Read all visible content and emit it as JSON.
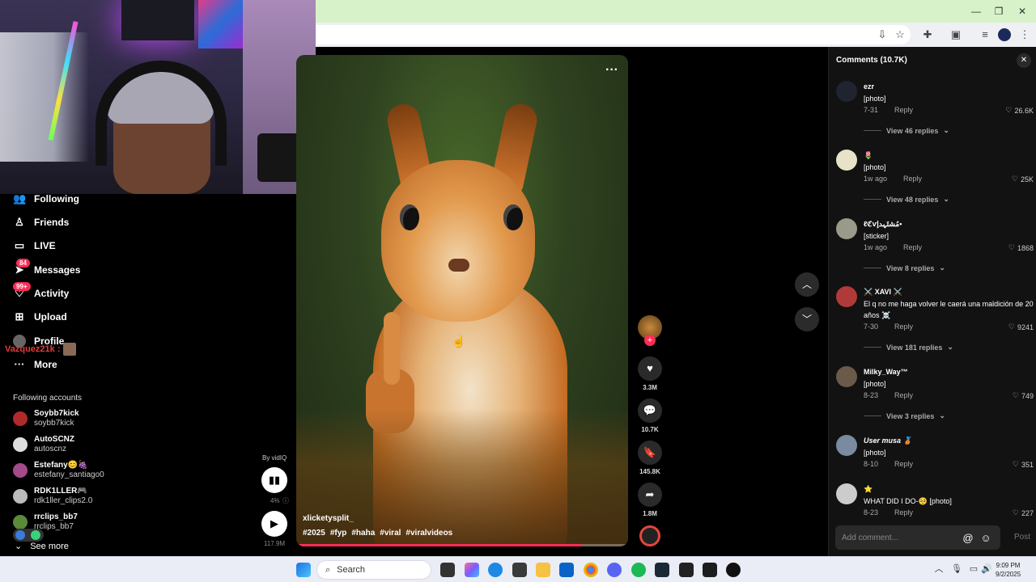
{
  "window": {
    "minimize": "—",
    "restore": "❐",
    "close": "✕"
  },
  "toolbar": {
    "icons": [
      "download-icon",
      "star-icon",
      "extensions-icon",
      "reading-mode-icon",
      "media-icon",
      "profile-icon",
      "menu-icon"
    ]
  },
  "nav": {
    "items": [
      {
        "label": "Following",
        "icon": "following-icon"
      },
      {
        "label": "Friends",
        "icon": "friends-icon"
      },
      {
        "label": "LIVE",
        "icon": "live-icon"
      },
      {
        "label": "Messages",
        "icon": "messages-icon",
        "badge": "84"
      },
      {
        "label": "Activity",
        "icon": "activity-icon",
        "badge": "99+"
      },
      {
        "label": "Upload",
        "icon": "upload-icon"
      },
      {
        "label": "Profile",
        "icon": "profile-icon"
      },
      {
        "label": "More",
        "icon": "more-icon"
      }
    ],
    "overlay_name": "Vazquez21k :"
  },
  "following": {
    "title": "Following accounts",
    "accounts": [
      {
        "name": "Soybb7kick",
        "user": "soybb7kick"
      },
      {
        "name": "AutoSCNZ",
        "user": "autoscnz"
      },
      {
        "name": "Estefany😊🍇",
        "user": "estefany_santiago0"
      },
      {
        "name": "RDK1LLER🎮",
        "user": "rdk1ller_clips2.0"
      },
      {
        "name": "rrclips_bb7",
        "user": "rrclips_bb7"
      }
    ],
    "see_more": "See more"
  },
  "vidiq": {
    "by": "By vidIQ",
    "percent": "4%",
    "views": "117.9M"
  },
  "video": {
    "author": "xlicketysplit_",
    "tags": [
      "#2025",
      "#fyp",
      "#haha",
      "#viral",
      "#viralvideos"
    ],
    "more": "···",
    "progress": 0.86
  },
  "actions": {
    "likes": "3.3M",
    "comments": "10.7K",
    "saves": "145.8K",
    "shares": "1.8M"
  },
  "comments": {
    "title": "Comments (10.7K)",
    "items": [
      {
        "user": "ezr",
        "text": "[photo]",
        "date": "7-31",
        "reply": "Reply",
        "likes": "26.6K",
        "replies": "View 46 replies"
      },
      {
        "user": "🌷",
        "text": "[photo]",
        "date": "1w ago",
        "reply": "Reply",
        "likes": "25K",
        "replies": "View 48 replies"
      },
      {
        "user": "ℓℭⱱمُشتَہدإ•",
        "text": "[sticker]",
        "date": "1w ago",
        "reply": "Reply",
        "likes": "1868",
        "replies": "View 8 replies"
      },
      {
        "user": "⚔️ XAVI ⚔️",
        "text": "El q no me haga volver le caerá una maldición de 20 años ☠️",
        "date": "7-30",
        "reply": "Reply",
        "likes": "9241",
        "replies": "View 181 replies"
      },
      {
        "user": "Milky_Way™",
        "text": "[photo]",
        "date": "8-23",
        "reply": "Reply",
        "likes": "749",
        "replies": "View 3 replies"
      },
      {
        "user": "User musa 🥉",
        "text": "[photo]",
        "date": "8-10",
        "reply": "Reply",
        "likes": "351"
      },
      {
        "user": "⭐",
        "text": "WHAT DID I DO-🥺 [photo]",
        "date": "8-23",
        "reply": "Reply",
        "likes": "227"
      }
    ],
    "input_placeholder": "Add comment...",
    "post": "Post"
  },
  "taskbar": {
    "search": "Search",
    "time": "9:09 PM",
    "date": "9/2/2025"
  },
  "colors": {
    "accent": "#fe2c55",
    "panel": "#121212"
  }
}
